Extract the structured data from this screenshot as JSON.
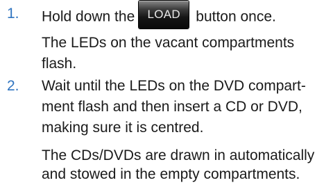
{
  "colors": {
    "step_number": "#2f74c0",
    "text": "#1a1a1a"
  },
  "steps": [
    {
      "number": "1.",
      "instruction_before": "Hold down the",
      "button_label": "LOAD",
      "instruction_after": "button once.",
      "result_lines": [
        "The LEDs on the vacant compartments",
        "flash."
      ]
    },
    {
      "number": "2.",
      "instruction_lines": [
        "Wait until the LEDs on the DVD compart-",
        "ment flash and then insert a CD or DVD,",
        "making sure it is centred."
      ],
      "result_lines": [
        "The CDs/DVDs are drawn in automatically",
        "and stowed in the empty compartments."
      ]
    }
  ]
}
